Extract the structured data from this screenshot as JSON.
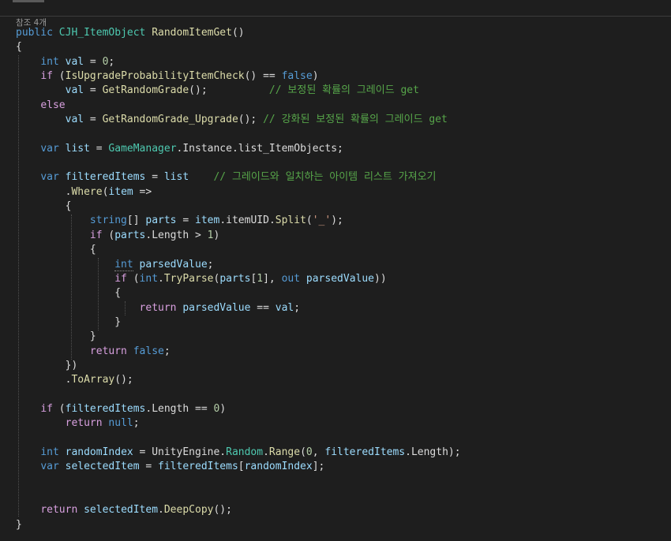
{
  "codelens": "참조 4개",
  "lines": [
    [
      [
        "kw",
        "public"
      ],
      [
        "pl",
        " "
      ],
      [
        "typ",
        "CJH_ItemObject"
      ],
      [
        "pl",
        " "
      ],
      [
        "fn",
        "RandomItemGet"
      ],
      [
        "pl",
        "()"
      ]
    ],
    [
      [
        "pl",
        "{"
      ]
    ],
    [
      [
        "pl",
        "    "
      ],
      [
        "kw",
        "int"
      ],
      [
        "pl",
        " "
      ],
      [
        "var",
        "val"
      ],
      [
        "pl",
        " = "
      ],
      [
        "num",
        "0"
      ],
      [
        "pl",
        ";"
      ]
    ],
    [
      [
        "pl",
        "    "
      ],
      [
        "ctl",
        "if"
      ],
      [
        "pl",
        " ("
      ],
      [
        "fn",
        "IsUpgradeProbabilityItemCheck"
      ],
      [
        "pl",
        "() == "
      ],
      [
        "kw",
        "false"
      ],
      [
        "pl",
        ")"
      ]
    ],
    [
      [
        "pl",
        "        "
      ],
      [
        "var",
        "val"
      ],
      [
        "pl",
        " = "
      ],
      [
        "fn",
        "GetRandomGrade"
      ],
      [
        "pl",
        "();          "
      ],
      [
        "cmt",
        "// 보정된 확률의 그레이드 get"
      ]
    ],
    [
      [
        "pl",
        "    "
      ],
      [
        "ctl",
        "else"
      ]
    ],
    [
      [
        "pl",
        "        "
      ],
      [
        "var",
        "val"
      ],
      [
        "pl",
        " = "
      ],
      [
        "fn",
        "GetRandomGrade_Upgrade"
      ],
      [
        "pl",
        "(); "
      ],
      [
        "cmt",
        "// 강화된 보정된 확률의 그레이드 get"
      ]
    ],
    [],
    [
      [
        "pl",
        "    "
      ],
      [
        "kw",
        "var"
      ],
      [
        "pl",
        " "
      ],
      [
        "var",
        "list"
      ],
      [
        "pl",
        " = "
      ],
      [
        "typ",
        "GameManager"
      ],
      [
        "pl",
        "."
      ],
      [
        "pl",
        "Instance"
      ],
      [
        "pl",
        "."
      ],
      [
        "pl",
        "list_ItemObjects;"
      ]
    ],
    [],
    [
      [
        "pl",
        "    "
      ],
      [
        "kw",
        "var"
      ],
      [
        "pl",
        " "
      ],
      [
        "var",
        "filteredItems"
      ],
      [
        "pl",
        " = "
      ],
      [
        "var",
        "list"
      ],
      [
        "pl",
        "    "
      ],
      [
        "cmt",
        "// 그레이드와 일치하는 아이템 리스트 가져오기"
      ]
    ],
    [
      [
        "pl",
        "        ."
      ],
      [
        "fn",
        "Where"
      ],
      [
        "pl",
        "("
      ],
      [
        "var",
        "item"
      ],
      [
        "pl",
        " =>"
      ]
    ],
    [
      [
        "pl",
        "        {"
      ]
    ],
    [
      [
        "pl",
        "            "
      ],
      [
        "kw",
        "string"
      ],
      [
        "pl",
        "[] "
      ],
      [
        "var",
        "parts"
      ],
      [
        "pl",
        " = "
      ],
      [
        "var",
        "item"
      ],
      [
        "pl",
        "."
      ],
      [
        "pl",
        "itemUID"
      ],
      [
        "pl",
        "."
      ],
      [
        "fn",
        "Split"
      ],
      [
        "pl",
        "("
      ],
      [
        "str",
        "'_'"
      ],
      [
        "pl",
        ");"
      ]
    ],
    [
      [
        "pl",
        "            "
      ],
      [
        "ctl",
        "if"
      ],
      [
        "pl",
        " ("
      ],
      [
        "var",
        "parts"
      ],
      [
        "pl",
        "."
      ],
      [
        "pl",
        "Length > "
      ],
      [
        "num",
        "1"
      ],
      [
        "pl",
        ")"
      ]
    ],
    [
      [
        "pl",
        "            {"
      ]
    ],
    [
      [
        "pl",
        "                "
      ],
      [
        "kw",
        "int"
      ],
      [
        "pl",
        " "
      ],
      [
        "var",
        "parsedValue"
      ],
      [
        "pl",
        ";"
      ]
    ],
    [
      [
        "pl",
        "                "
      ],
      [
        "ctl",
        "if"
      ],
      [
        "pl",
        " ("
      ],
      [
        "kw",
        "int"
      ],
      [
        "pl",
        "."
      ],
      [
        "fn",
        "TryParse"
      ],
      [
        "pl",
        "("
      ],
      [
        "var",
        "parts"
      ],
      [
        "pl",
        "["
      ],
      [
        "num",
        "1"
      ],
      [
        "pl",
        "], "
      ],
      [
        "kw",
        "out"
      ],
      [
        "pl",
        " "
      ],
      [
        "var",
        "parsedValue"
      ],
      [
        "pl",
        "))"
      ]
    ],
    [
      [
        "pl",
        "                {"
      ]
    ],
    [
      [
        "pl",
        "                    "
      ],
      [
        "ctl",
        "return"
      ],
      [
        "pl",
        " "
      ],
      [
        "var",
        "parsedValue"
      ],
      [
        "pl",
        " == "
      ],
      [
        "var",
        "val"
      ],
      [
        "pl",
        ";"
      ]
    ],
    [
      [
        "pl",
        "                }"
      ]
    ],
    [
      [
        "pl",
        "            }"
      ]
    ],
    [
      [
        "pl",
        "            "
      ],
      [
        "ctl",
        "return"
      ],
      [
        "pl",
        " "
      ],
      [
        "kw",
        "false"
      ],
      [
        "pl",
        ";"
      ]
    ],
    [
      [
        "pl",
        "        })"
      ]
    ],
    [
      [
        "pl",
        "        ."
      ],
      [
        "fn",
        "ToArray"
      ],
      [
        "pl",
        "();"
      ]
    ],
    [],
    [
      [
        "pl",
        "    "
      ],
      [
        "ctl",
        "if"
      ],
      [
        "pl",
        " ("
      ],
      [
        "var",
        "filteredItems"
      ],
      [
        "pl",
        "."
      ],
      [
        "pl",
        "Length == "
      ],
      [
        "num",
        "0"
      ],
      [
        "pl",
        ")"
      ]
    ],
    [
      [
        "pl",
        "        "
      ],
      [
        "ctl",
        "return"
      ],
      [
        "pl",
        " "
      ],
      [
        "kw",
        "null"
      ],
      [
        "pl",
        ";"
      ]
    ],
    [],
    [
      [
        "pl",
        "    "
      ],
      [
        "kw",
        "int"
      ],
      [
        "pl",
        " "
      ],
      [
        "var",
        "randomIndex"
      ],
      [
        "pl",
        " = "
      ],
      [
        "pl",
        "UnityEngine"
      ],
      [
        "pl",
        "."
      ],
      [
        "typ",
        "Random"
      ],
      [
        "pl",
        "."
      ],
      [
        "fn",
        "Range"
      ],
      [
        "pl",
        "("
      ],
      [
        "num",
        "0"
      ],
      [
        "pl",
        ", "
      ],
      [
        "var",
        "filteredItems"
      ],
      [
        "pl",
        "."
      ],
      [
        "pl",
        "Length);"
      ]
    ],
    [
      [
        "pl",
        "    "
      ],
      [
        "kw",
        "var"
      ],
      [
        "pl",
        " "
      ],
      [
        "var",
        "selectedItem"
      ],
      [
        "pl",
        " = "
      ],
      [
        "var",
        "filteredItems"
      ],
      [
        "pl",
        "["
      ],
      [
        "var",
        "randomIndex"
      ],
      [
        "pl",
        "];"
      ]
    ],
    [],
    [],
    [
      [
        "pl",
        "    "
      ],
      [
        "ctl",
        "return"
      ],
      [
        "pl",
        " "
      ],
      [
        "var",
        "selectedItem"
      ],
      [
        "pl",
        "."
      ],
      [
        "fn",
        "DeepCopy"
      ],
      [
        "pl",
        "();"
      ]
    ],
    [
      [
        "pl",
        "}"
      ]
    ]
  ]
}
